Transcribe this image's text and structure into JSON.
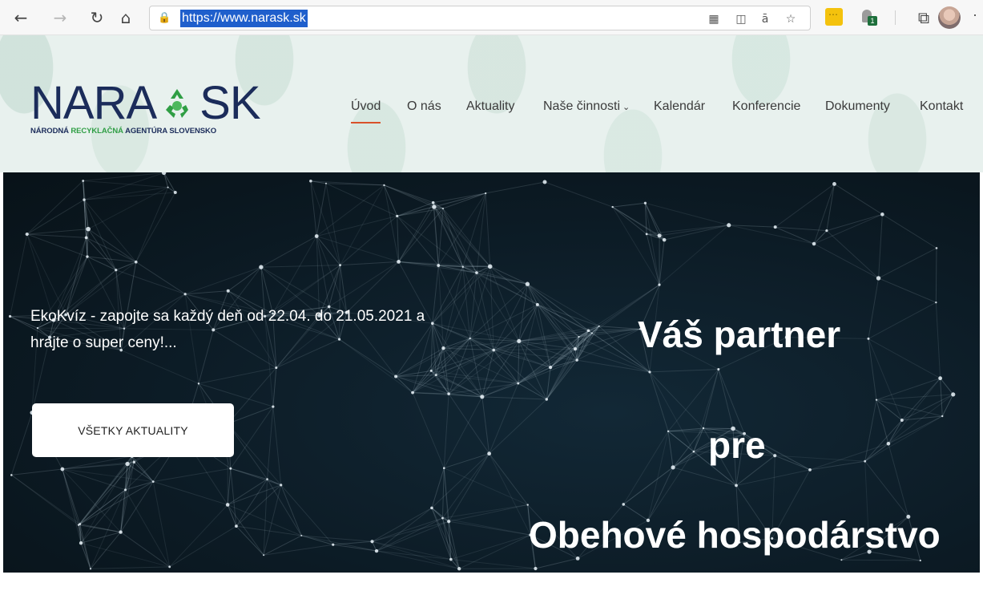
{
  "browser": {
    "url": "https://www.narask.sk",
    "icons": {
      "back": "back-arrow-icon",
      "forward": "forward-arrow-icon",
      "reload": "reload-icon",
      "home": "home-icon",
      "lock": "lock-icon",
      "apps": "app-grid-icon",
      "reader": "reader-view-icon",
      "translate": "translate-icon",
      "favorite": "favorite-star-icon",
      "collections": "collections-icon",
      "more": "more-menu-icon"
    },
    "extension_badge": "1"
  },
  "site": {
    "logo": {
      "word_left": "NARA",
      "word_right": "SK",
      "tagline_part1": "NÁRODNÁ ",
      "tagline_part2": "RECYKLAČNÁ",
      "tagline_part3": " AGENTÚRA SLOVENSKO",
      "symbol_color": "#2f9e44"
    },
    "nav": {
      "items": [
        {
          "label": "Úvod",
          "active": true
        },
        {
          "label": "O nás"
        },
        {
          "label": "Aktuality"
        },
        {
          "label": "Naše činnosti",
          "has_dropdown": true
        },
        {
          "label": "Kalendár"
        },
        {
          "label": "Konferencie"
        },
        {
          "label": "Dokumenty"
        },
        {
          "label": "Kontakt"
        }
      ],
      "active_underline_color": "#d9502a"
    }
  },
  "hero": {
    "news_text": "EkoKvíz - zapojte sa každý deň od 22.04. do 21.05.2021 a hrajte o super ceny!...",
    "button_label": "VŠETKY AKTUALITY",
    "headline": [
      "Váš partner",
      "pre",
      "Obehové hospodárstvo"
    ]
  }
}
